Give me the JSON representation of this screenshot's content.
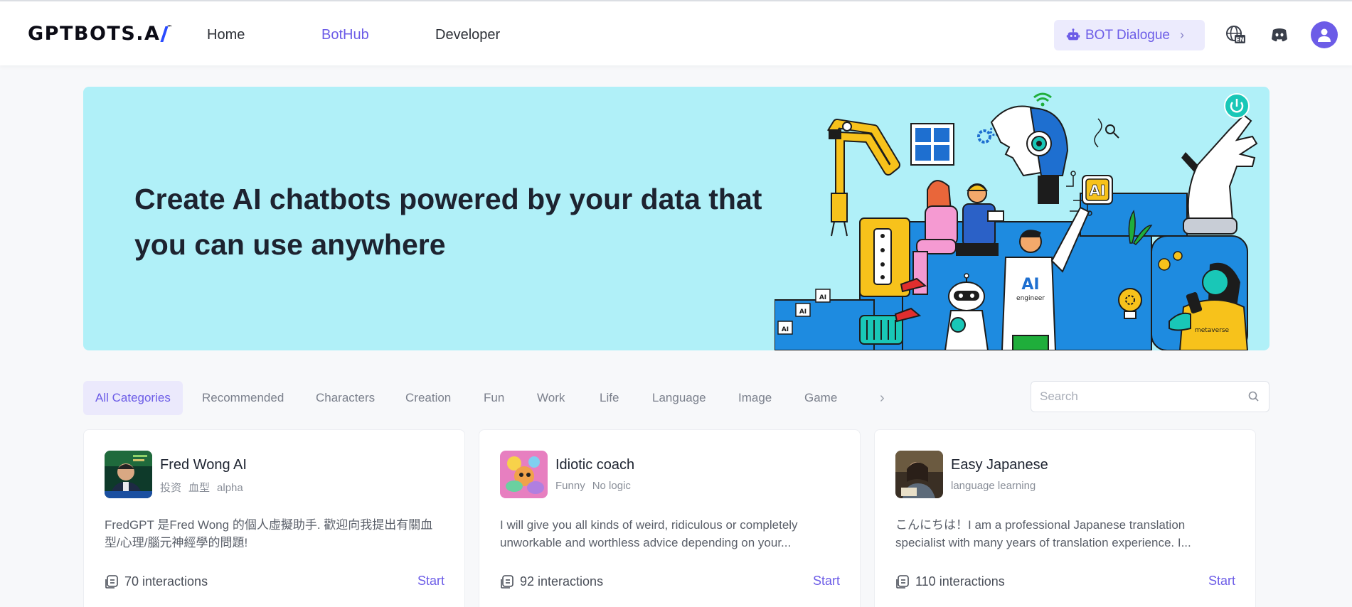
{
  "header": {
    "logo_text": "GPTBOTS.A",
    "logo_tm": "™",
    "nav": [
      {
        "label": "Home"
      },
      {
        "label": "BotHub"
      },
      {
        "label": "Developer"
      }
    ],
    "bot_dialogue_label": "BOT Dialogue",
    "language_icon": "language-en-icon",
    "discord_icon": "discord-icon",
    "avatar_icon": "user-icon",
    "accent_color": "#6c5ce7"
  },
  "banner": {
    "title": "Create AI chatbots powered by your data that you can use anywhere",
    "background_color": "#b0f0f8",
    "art_labels": {
      "ai_sign": "AI",
      "ai_engineer": "AI",
      "engineer": "engineer",
      "metaverse": "metaverse",
      "chip_1": "AI",
      "chip_2": "AI",
      "chip_3": "AI"
    }
  },
  "categories": {
    "items": [
      {
        "label": "All Categories"
      },
      {
        "label": "Recommended"
      },
      {
        "label": "Characters"
      },
      {
        "label": "Creation"
      },
      {
        "label": "Fun"
      },
      {
        "label": "Work"
      },
      {
        "label": "Life"
      },
      {
        "label": "Language"
      },
      {
        "label": "Image"
      },
      {
        "label": "Game"
      }
    ],
    "active": "All Categories",
    "next_icon": "chevron-right-icon"
  },
  "search": {
    "placeholder": "Search",
    "value": ""
  },
  "cards": [
    {
      "name": "Fred Wong AI",
      "tags": [
        "投资",
        "血型",
        "alpha"
      ],
      "description": "FredGPT 是Fred Wong 的個人虛擬助手. 歡迎向我提出有關血型/心理/腦元神經學的問題!",
      "interactions": "70 interactions",
      "start_label": "Start"
    },
    {
      "name": "Idiotic coach",
      "tags": [
        "Funny",
        "No logic"
      ],
      "description": "I will give you all kinds of weird, ridiculous or completely unworkable and worthless advice depending on your...",
      "interactions": "92 interactions",
      "start_label": "Start"
    },
    {
      "name": "Easy Japanese",
      "tags": [
        "language learning"
      ],
      "description": "こんにちは！I am a professional Japanese translation specialist with many years of translation experience. I...",
      "interactions": "110 interactions",
      "start_label": "Start"
    }
  ]
}
